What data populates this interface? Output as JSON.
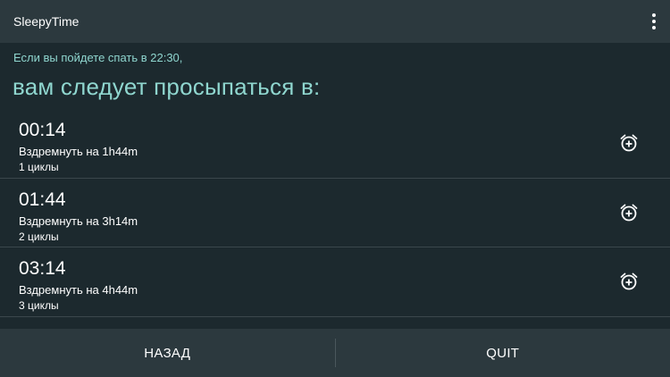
{
  "action_bar": {
    "title": "SleepyTime",
    "menu_icon": "overflow-vertical-icon"
  },
  "main": {
    "subhead": "Если вы пойдете спать в 22:30,",
    "headline": "вам следует просыпаться в:",
    "items": [
      {
        "time": "00:14",
        "nap": "Вздремнуть на 1h44m",
        "cycles": "1 циклы",
        "icon": "alarm-add-icon"
      },
      {
        "time": "01:44",
        "nap": "Вздремнуть на 3h14m",
        "cycles": "2 циклы",
        "icon": "alarm-add-icon"
      },
      {
        "time": "03:14",
        "nap": "Вздремнуть на 4h44m",
        "cycles": "3 циклы",
        "icon": "alarm-add-icon"
      }
    ]
  },
  "bottom_bar": {
    "back_label": "НАЗАД",
    "quit_label": "QUIT"
  },
  "colors": {
    "accent": "#8fd6cf",
    "background": "#1c292e",
    "bar": "#2c393e",
    "divider": "#3b474c"
  }
}
